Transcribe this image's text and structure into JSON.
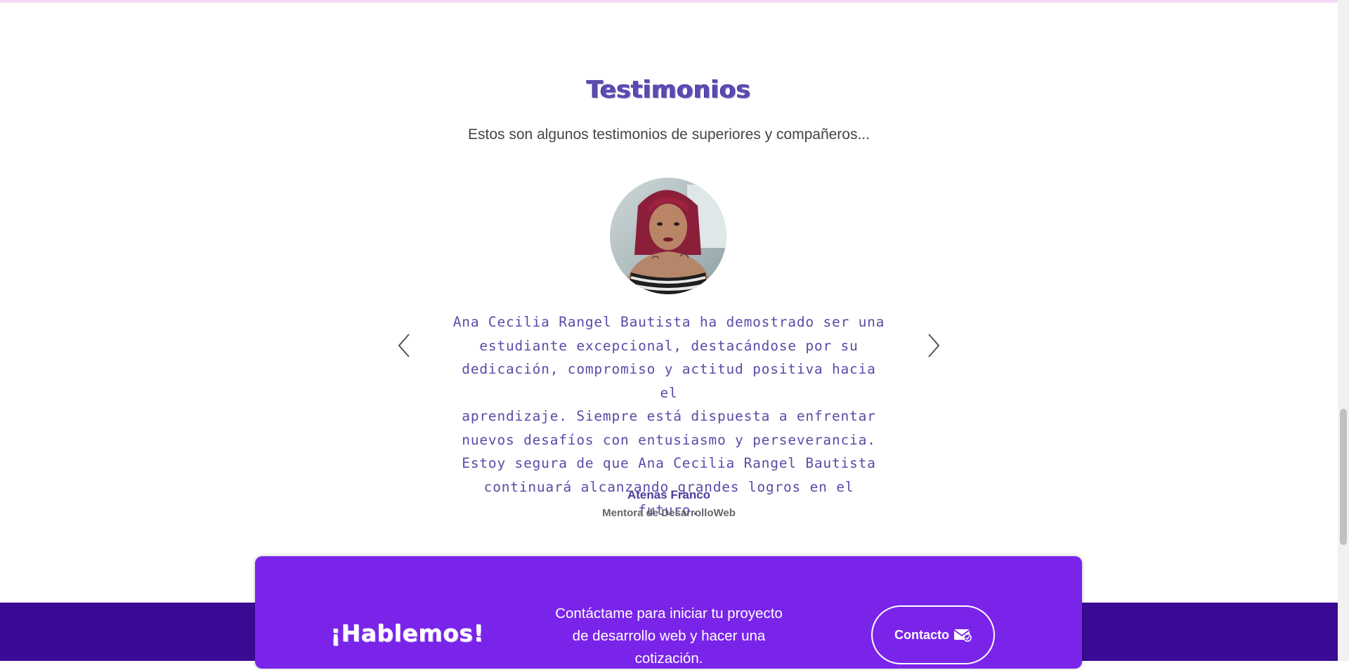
{
  "testimonials": {
    "title": "Testimonios",
    "subtitle": "Estos son algunos testimonios de superiores y compañeros...",
    "quote_lines": [
      "Ana Cecilia Rangel Bautista ha demostrado ser una",
      "estudiante excepcional, destacándose por su",
      "dedicación, compromiso y actitud positiva hacia el",
      "aprendizaje. Siempre está dispuesta a enfrentar",
      "nuevos desafíos con entusiasmo y perseverancia.",
      "Estoy segura de que Ana Cecilia Rangel Bautista",
      "continuará alcanzando grandes logros en el futuro."
    ],
    "author": "Atenas Franco",
    "role": "Mentora de DesarrolloWeb",
    "icons": {
      "prev": "chevron-left-icon",
      "next": "chevron-right-icon"
    }
  },
  "cta": {
    "title": "¡Hablemos!",
    "text_lines": [
      "Contáctame para iniciar tu proyecto",
      "de desarrollo web y hacer una",
      "cotización."
    ],
    "button_label": "Contacto",
    "button_icon": "mail-check-icon"
  },
  "colors": {
    "accent": "#7a24ea",
    "footer": "#3b0b96",
    "quote": "#5a4ba8"
  }
}
